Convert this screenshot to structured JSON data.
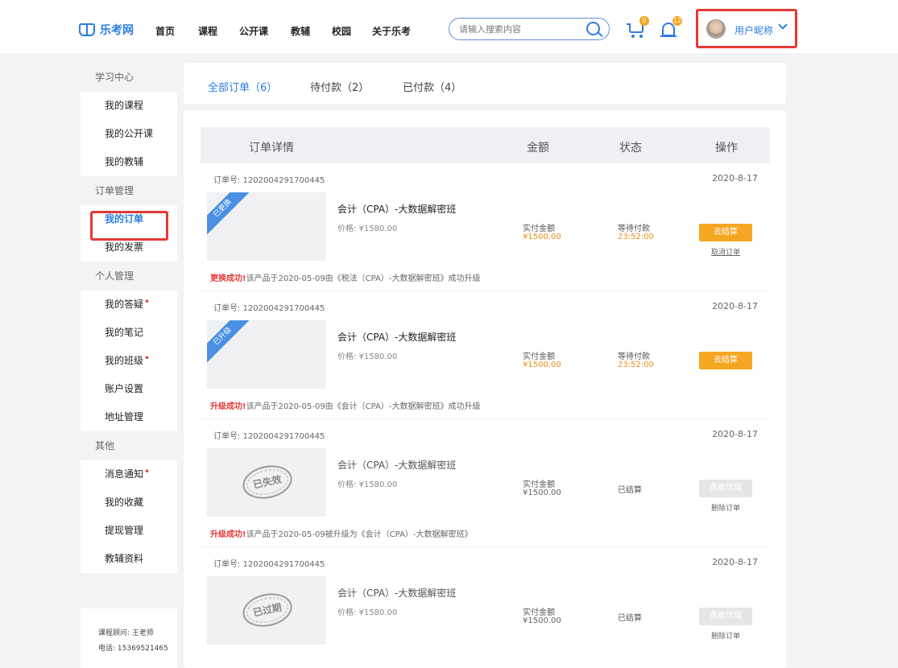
{
  "header": {
    "logo": "乐考网",
    "nav": [
      "首页",
      "课程",
      "公开课",
      "教辅",
      "校园",
      "关于乐考"
    ],
    "search_placeholder": "请输入搜索内容",
    "cart_count": "0",
    "notify_count": "12",
    "username": "用户昵称"
  },
  "sidebar": {
    "groups": [
      {
        "title": "学习中心",
        "items": [
          {
            "label": "我的课程"
          },
          {
            "label": "我的公开课"
          },
          {
            "label": "我的教辅"
          }
        ]
      },
      {
        "title": "订单管理",
        "items": [
          {
            "label": "我的订单"
          },
          {
            "label": "我的发票"
          }
        ]
      },
      {
        "title": "个人管理",
        "items": [
          {
            "label": "我的答疑",
            "dot": "•"
          },
          {
            "label": "我的笔记"
          },
          {
            "label": "我的班级",
            "dot": "•"
          },
          {
            "label": "账户设置"
          },
          {
            "label": "地址管理"
          }
        ]
      },
      {
        "title": "其他",
        "items": [
          {
            "label": "消息通知",
            "dot": "•"
          },
          {
            "label": "我的收藏"
          },
          {
            "label": "提现管理"
          },
          {
            "label": "教辅资料"
          }
        ]
      }
    ],
    "contact": {
      "advisor": "课程顾问: 王老师",
      "phone": "电话: 15369521465"
    }
  },
  "tabs": [
    "全部订单（6）",
    "待付款（2）",
    "已付款（4）"
  ],
  "table_head": {
    "detail": "订单详情",
    "amount": "金额",
    "status": "状态",
    "action": "操作"
  },
  "orders": [
    {
      "order_no": "订单号: 1202004291700445",
      "date": "2020-8-17",
      "ribbon": "已更换",
      "title": "会计（CPA）-大数据解密班",
      "price": "价格: ¥1580.00",
      "pay_label": "实付金额",
      "pay_value": "¥1500.00",
      "status": "等待付款",
      "countdown": "23:52:00",
      "button": "去结算",
      "link": "取消订单",
      "note_red": "更换成功!",
      "note": "该产品于2020-05-09由《税法（CPA）-大数据解密班》成功升级"
    },
    {
      "order_no": "订单号: 1202004291700445",
      "date": "2020-8-17",
      "ribbon": "已升级",
      "title": "会计（CPA）-大数据解密班",
      "price": "价格: ¥1580.00",
      "pay_label": "实付金额",
      "pay_value": "¥1500.00",
      "status": "等待付款",
      "countdown": "23:52:00",
      "button": "去结算",
      "note_red": "升级成功!",
      "note": "该产品于2020-05-09由《会计（CPA）-大数据解密班》成功升级"
    },
    {
      "order_no": "订单号: 1202004291700445",
      "date": "2020-8-17",
      "stamp": "已失效",
      "title": "会计（CPA）-大数据解密班",
      "price": "价格: ¥1580.00",
      "pay_label": "实付金额",
      "pay_value": "¥1500.00",
      "status": "已结算",
      "button": "查看详情",
      "link": "删除订单",
      "note_red": "升级成功!",
      "note": "该产品于2020-05-09被升级为《会计（CPA）-大数据解密班》"
    },
    {
      "order_no": "订单号: 1202004291700445",
      "date": "2020-8-17",
      "stamp": "已过期",
      "title": "会计（CPA）-大数据解密班",
      "price": "价格: ¥1580.00",
      "pay_label": "实付金额",
      "pay_value": "¥1500.00",
      "status": "已结算",
      "button": "查看详情",
      "link": "删除订单"
    }
  ]
}
